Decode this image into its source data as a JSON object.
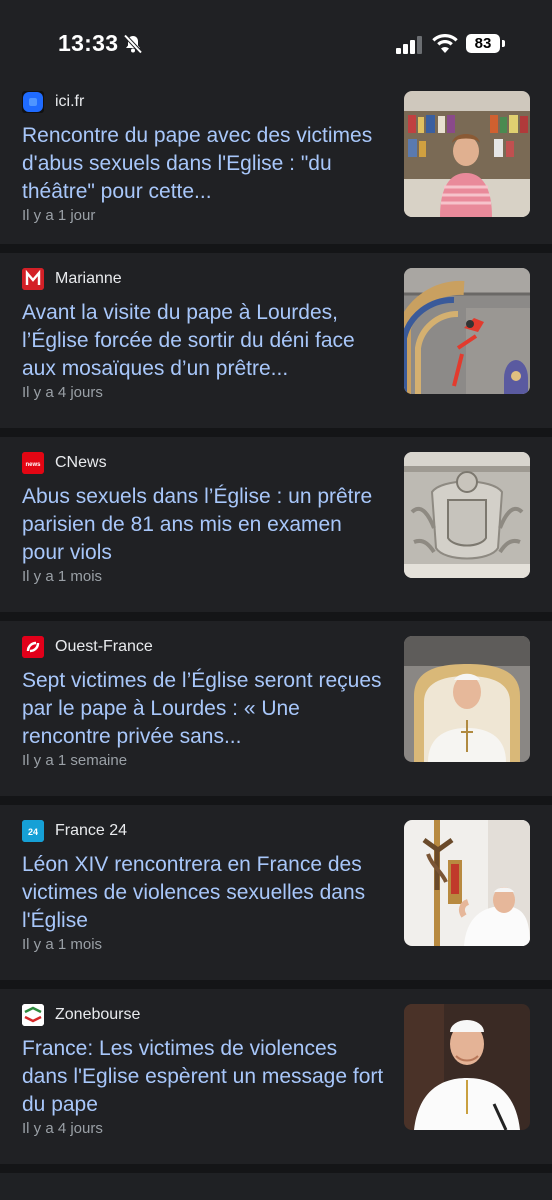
{
  "status": {
    "time": "13:33",
    "battery": "83"
  },
  "articles": [
    {
      "source": "ici.fr",
      "icon": "ici-logo-icon",
      "headline": "Rencontre du pape avec des victimes d'abus sexuels dans l'Eglise : \"du théâtre\" pour cette...",
      "time": "Il y a 1 jour"
    },
    {
      "source": "Marianne",
      "icon": "marianne-logo-icon",
      "headline": "Avant la visite du pape à Lourdes, l’Église forcée de sortir du déni face aux mosaïques d’un prêtre...",
      "time": "Il y a 4 jours"
    },
    {
      "source": "CNews",
      "icon": "cnews-logo-icon",
      "headline": "Abus sexuels dans l’Église : un prêtre parisien de 81 ans mis en examen pour viols",
      "time": "Il y a 1 mois"
    },
    {
      "source": "Ouest-France",
      "icon": "ouest-france-logo-icon",
      "headline": "Sept victimes de l’Église seront reçues par le pape à Lourdes : « Une rencontre privée sans...",
      "time": "Il y a 1 semaine"
    },
    {
      "source": "France 24",
      "icon": "france24-logo-icon",
      "headline": "Léon XIV rencontrera en France des victimes de violences sexuelles dans l'Église",
      "time": "Il y a 1 mois"
    },
    {
      "source": "Zonebourse",
      "icon": "zonebourse-logo-icon",
      "headline": "France: Les victimes de violences dans l'Eglise espèrent un message fort du pape",
      "time": "Il y a 4 jours"
    }
  ]
}
